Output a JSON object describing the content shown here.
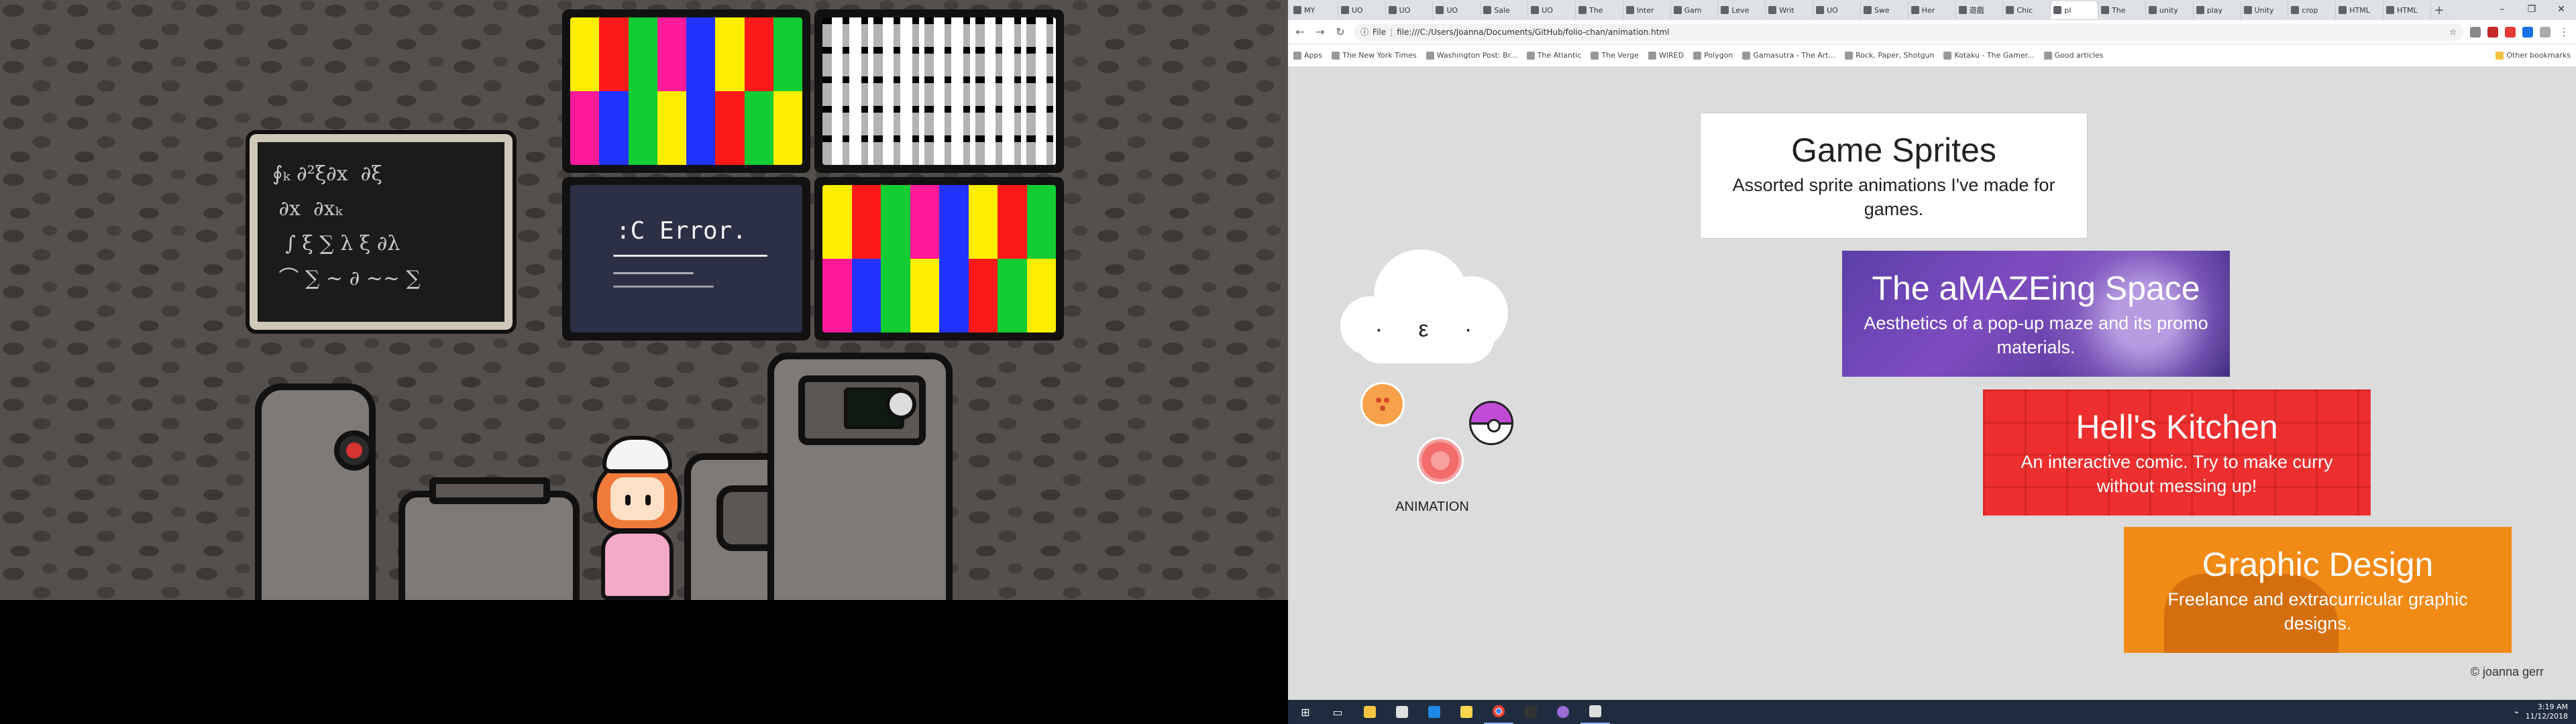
{
  "game": {
    "error_text": ":C Error."
  },
  "browser": {
    "tabs": [
      {
        "label": "MY"
      },
      {
        "label": "UO"
      },
      {
        "label": "UO"
      },
      {
        "label": "UO"
      },
      {
        "label": "Sale"
      },
      {
        "label": "UO"
      },
      {
        "label": "The"
      },
      {
        "label": "Inter"
      },
      {
        "label": "Gam"
      },
      {
        "label": "Leve"
      },
      {
        "label": "Writ"
      },
      {
        "label": "UO"
      },
      {
        "label": "Swe"
      },
      {
        "label": "Her"
      },
      {
        "label": "遊戲"
      },
      {
        "label": "Chic"
      },
      {
        "label": "pl"
      },
      {
        "label": "The"
      },
      {
        "label": "unity"
      },
      {
        "label": "play"
      },
      {
        "label": "Unity"
      },
      {
        "label": "crop"
      },
      {
        "label": "HTML"
      },
      {
        "label": "HTML"
      }
    ],
    "active_tab_index": 16,
    "new_tab": "+",
    "controls": {
      "minimize": "–",
      "maximize": "❐",
      "close": "✕"
    },
    "address_scheme": "File",
    "address": "file:///C:/Users/Joanna/Documents/GitHub/folio-chan/animation.html",
    "bookmarks": [
      "Apps",
      "The New York Times",
      "Washington Post: Br...",
      "The Atlantic",
      "The Verge",
      "WIRED",
      "Polygon",
      "Gamasutra - The Art...",
      "Rock, Paper, Shotgun",
      "Kotaku - The Gamer...",
      "Good articles"
    ],
    "other_bookmarks": "Other bookmarks"
  },
  "page": {
    "cloud_face": "· ε ·",
    "nav_label": "ANIMATION",
    "cards": [
      {
        "title": "Game Sprites",
        "description": "Assorted sprite animations I've made for games."
      },
      {
        "title": "The aMAZEing Space",
        "description": "Aesthetics of a pop-up maze and its promo materials."
      },
      {
        "title": "Hell's Kitchen",
        "description": "An interactive comic. Try to make curry without messing up!"
      },
      {
        "title": "Graphic Design",
        "description": "Freelance and extracurricular graphic designs."
      }
    ],
    "copyright": "© joanna gerr"
  },
  "taskbar": {
    "time": "3:19 AM",
    "date": "11/12/2018"
  },
  "colors": {
    "tv_bars": [
      "#ffee00",
      "#ff1a1a",
      "#11cc33",
      "#ff1a9a",
      "#2233ff",
      "#ffee00",
      "#ff1a1a",
      "#11cc33"
    ],
    "tv_bars_bottom": [
      "#ff1a9a",
      "#2233ff",
      "#11cc33",
      "#ffee00",
      "#2233ff",
      "#ff1a1a",
      "#11cc33",
      "#ffee00"
    ]
  }
}
